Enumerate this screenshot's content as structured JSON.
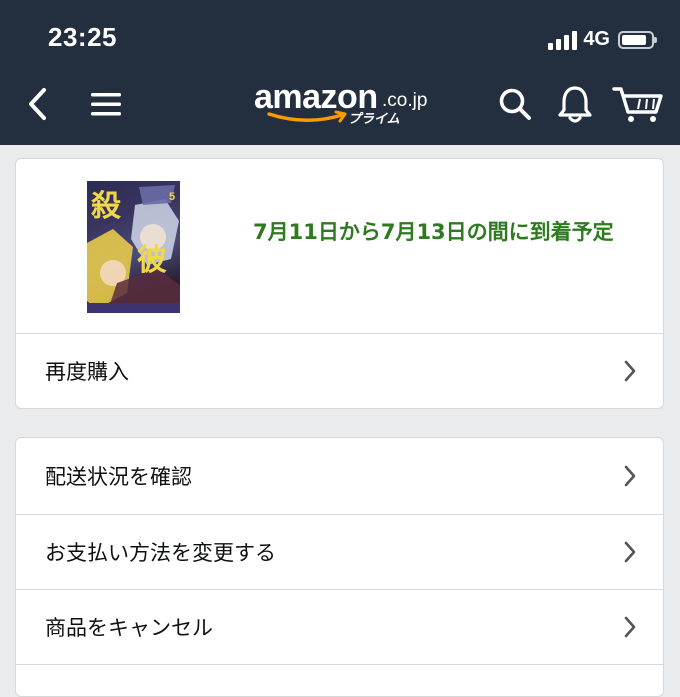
{
  "status_bar": {
    "time": "23:25",
    "network": "4G",
    "battery_level": 0.85
  },
  "nav": {
    "logo_word": "amazon",
    "logo_tld": ".co.jp",
    "logo_prime": "プライム",
    "icons": [
      "back-arrow-icon",
      "hamburger-menu-icon",
      "search-icon",
      "bell-icon",
      "cart-icon"
    ]
  },
  "order": {
    "cover_title_chars": [
      "殺",
      "彼"
    ],
    "cover_volume": "5",
    "delivery_text": "7月11日から7月13日の間に到着予定",
    "buy_again_label": "再度購入"
  },
  "actions": [
    {
      "label": "配送状況を確認"
    },
    {
      "label": "お支払い方法を変更する"
    },
    {
      "label": "商品をキャンセル"
    }
  ],
  "colors": {
    "header_bg": "#232f3e",
    "delivery_green": "#2d7a1f",
    "page_bg": "#e9ebed",
    "smile_orange": "#ff9900"
  }
}
